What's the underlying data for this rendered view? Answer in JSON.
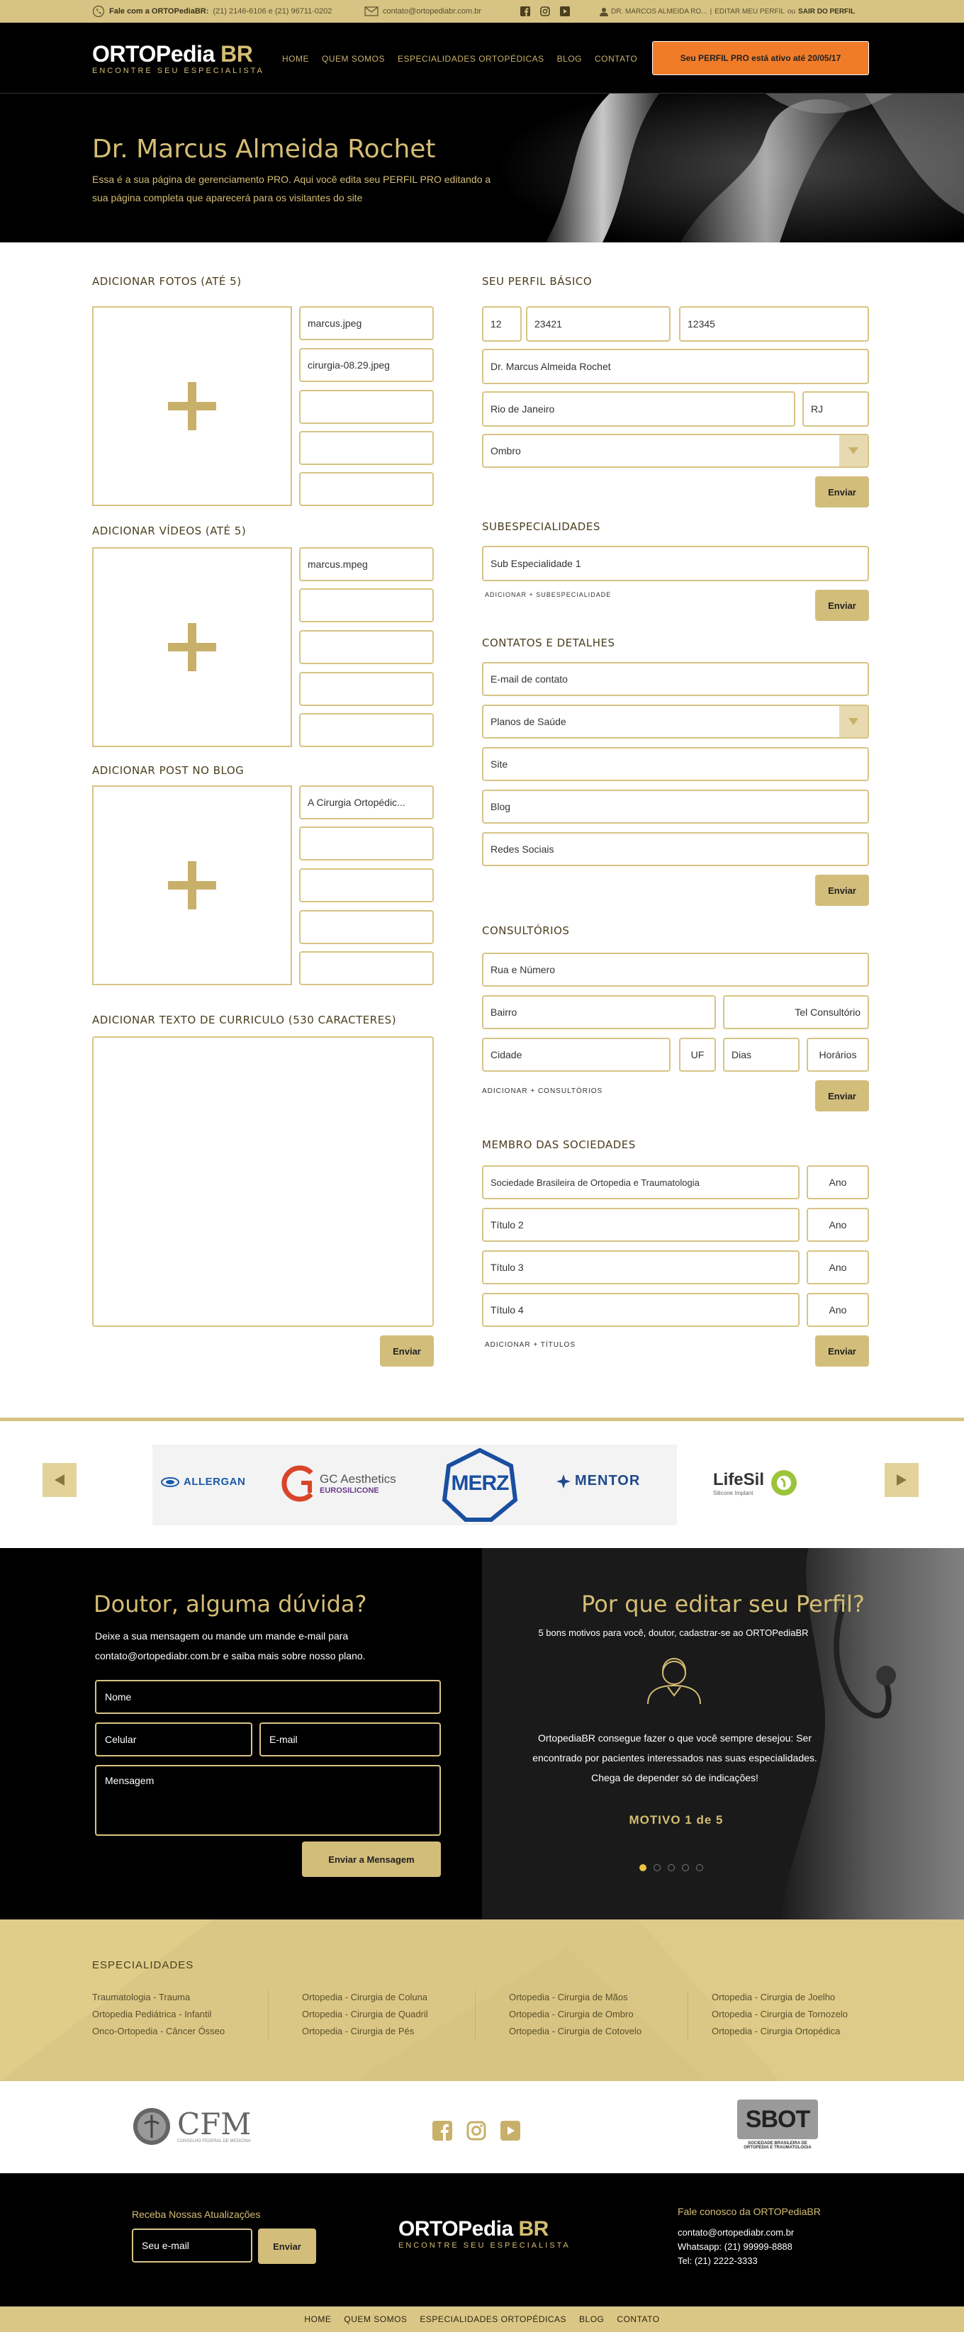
{
  "topbar": {
    "contact_label": "Fale com a ORTOPediaBR:",
    "phones": "(21) 2146-6106 e (21) 96711-0202",
    "email": "contato@ortopediabr.com.br",
    "user_prefix": "DR. MARCOS ALMEIDA RO...",
    "edit_link": "EDITAR MEU PERFIL",
    "or": "ou",
    "logout_link": "SAIR DO PERFIL"
  },
  "header": {
    "logo_main": "ORTOPedia",
    "logo_accent": "BR",
    "logo_tagline": "ENCONTRE SEU ESPECIALISTA",
    "nav": [
      "HOME",
      "QUEM SOMOS",
      "ESPECIALIDADES ORTOPÉDICAS",
      "BLOG",
      "CONTATO"
    ],
    "pro_button": "Seu PERFIL PRO está ativo até 20/05/17"
  },
  "hero": {
    "title": "Dr. Marcus Almeida Rochet",
    "text": "Essa é a sua página de gerenciamento PRO. Aqui você edita seu PERFIL PRO editando a sua página completa que aparecerá para os visitantes do site"
  },
  "photos": {
    "title": "ADICIONAR FOTOS (ATÉ 5)",
    "files": [
      "marcus.jpeg",
      "cirurgia-08.29.jpeg",
      "",
      "",
      ""
    ]
  },
  "videos": {
    "title": "ADICIONAR VÍDEOS (ATÉ 5)",
    "files": [
      "marcus.mpeg",
      "",
      "",
      "",
      ""
    ]
  },
  "blog": {
    "title": "ADICIONAR POST NO BLOG",
    "files": [
      "A Cirurgia Ortopédic...",
      "",
      "",
      "",
      ""
    ]
  },
  "cv": {
    "title": "ADICIONAR TEXTO DE CURRICULO (530 CARACTERES)",
    "submit": "Enviar"
  },
  "profile": {
    "title": "SEU PERFIL BÁSICO",
    "f1": "12",
    "f2": "23421",
    "f3": "12345",
    "name": "Dr. Marcus Almeida Rochet",
    "city": "Rio de Janeiro",
    "state": "RJ",
    "specialty": "Ombro",
    "submit": "Enviar"
  },
  "subspecialties": {
    "title": "SUBESPECIALIDADES",
    "value": "Sub Especialidade 1",
    "add_link": "ADICIONAR + SUBESPECIALIDADE",
    "submit": "Enviar"
  },
  "contacts": {
    "title": "CONTATOS E DETALHES",
    "email_ph": "E-mail de contato",
    "plans": "Planos de Saúde",
    "site_ph": "Site",
    "blog_ph": "Blog",
    "social_ph": "Redes Sociais",
    "submit": "Enviar"
  },
  "offices": {
    "title": "CONSULTÓRIOS",
    "street_ph": "Rua e Número",
    "district_ph": "Bairro",
    "phone_ph": "Tel Consultório",
    "city_ph": "Cidade",
    "uf_ph": "UF",
    "days_ph": "Dias",
    "hours_ph": "Horários",
    "add_link": "ADICIONAR + CONSULTÓRIOS",
    "submit": "Enviar"
  },
  "societies": {
    "title": "MEMBRO DAS SOCIEDADES",
    "rows": [
      {
        "name": "Sociedade Brasileira de Ortopedia e Traumatologia",
        "year": "Ano"
      },
      {
        "name": "Título 2",
        "year": "Ano"
      },
      {
        "name": "Título 3",
        "year": "Ano"
      },
      {
        "name": "Título 4",
        "year": "Ano"
      }
    ],
    "add_link": "ADICIONAR + TÍTULOS",
    "submit": "Enviar"
  },
  "partners": {
    "allergan": "ALLERGAN",
    "gc": "GC Aesthetics",
    "gc_sub": "EUROSILICONE",
    "merz": "MERZ",
    "mentor": "MENTOR",
    "lifesil": "LifeSil",
    "lifesil_sub": "Silicone Implant"
  },
  "doubt": {
    "title": "Doutor, alguma dúvida?",
    "text": "Deixe a sua mensagem ou mande um mande e-mail para contato@ortopediabr.com.br e saiba mais sobre nosso plano.",
    "name_ph": "Nome",
    "phone_ph": "Celular",
    "email_ph": "E-mail",
    "message_ph": "Mensagem",
    "submit": "Enviar a Mensagem"
  },
  "why": {
    "title": "Por que  editar seu Perfil?",
    "subtitle": "5 bons motivos para você, doutor, cadastrar-se ao ORTOPediaBR",
    "text": "OrtopediaBR consegue fazer o que você sempre desejou: Ser encontrado por pacientes interessados nas suas especialidades. Chega de depender só de indicações!",
    "motive": "MOTIVO 1 de 5"
  },
  "especialidades": {
    "title": "ESPECIALIDADES",
    "cols": [
      [
        "Traumatologia - Trauma",
        "Ortopedia Pediátrica - Infantil",
        "Onco-Ortopedia - Câncer Ósseo"
      ],
      [
        "Ortopedia - Cirurgia de Coluna",
        "Ortopedia - Cirurgia de Quadril",
        "Ortopedia - Cirurgia de Pés"
      ],
      [
        "Ortopedia - Cirurgia de Mãos",
        "Ortopedia - Cirurgia de Ombro",
        "Ortopedia - Cirurgia de Cotovelo"
      ],
      [
        "Ortopedia - Cirurgia de Joelho",
        "Ortopedia - Cirurgia de Tornozelo",
        "Ortopedia - Cirurgia Ortopédica"
      ]
    ]
  },
  "bottom_logos": {
    "cfm": "CFM",
    "cfm_sub": "CONSELHO FEDERAL DE MEDICINA",
    "sbot": "SBOT",
    "sbot_sub": "SOCIEDADE BRASILEIRA DE ORTOPEDIA E TRAUMATOLOGIA"
  },
  "footer": {
    "newsletter_title": "Receba Nossas Atualizações",
    "newsletter_ph": "Seu e-mail",
    "newsletter_btn": "Enviar",
    "logo_main": "ORTOPedia",
    "logo_accent": "BR",
    "logo_tagline": "ENCONTRE SEU ESPECIALISTA",
    "contact_title": "Fale conosco da ORTOPediaBR",
    "contact_email": "contato@ortopediabr.com.br",
    "contact_whatsapp": "Whatsapp: (21) 99999-8888",
    "contact_tel": "Tel: (21) 2222-3333",
    "nav": [
      "HOME",
      "QUEM SOMOS",
      "ESPECIALIDADES ORTOPÉDICAS",
      "BLOG",
      "CONTATO"
    ]
  }
}
